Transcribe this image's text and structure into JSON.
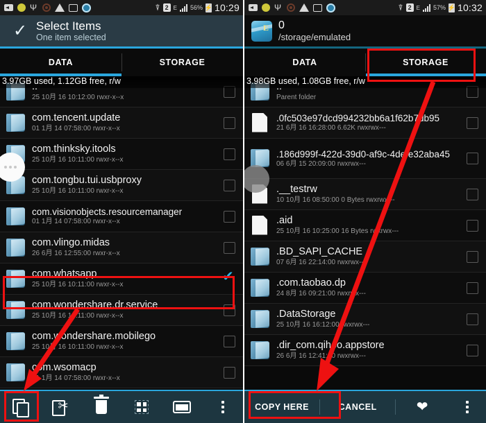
{
  "left": {
    "statusbar": {
      "icons": [
        "sdcard-icon",
        "coin-icon",
        "usb-icon",
        "record-icon",
        "warning-icon",
        "image-icon",
        "shield-icon"
      ],
      "wifi": "wifi-icon",
      "sim": "2",
      "network": "E",
      "battery_pct": "56%",
      "clock": "10:29"
    },
    "header": {
      "title": "Select Items",
      "subtitle": "One item selected",
      "check_icon": "check-icon"
    },
    "tabs": [
      {
        "label": "DATA",
        "selected": true
      },
      {
        "label": "STORAGE",
        "selected": false
      }
    ],
    "storage_info": "3.97GB used, 1.12GB free, r/w",
    "rows": [
      {
        "name": "..",
        "sub_date": "25 10月 16 10:12:00",
        "sub_perm": "rwxr-x--x",
        "type": "folder",
        "checked": false
      },
      {
        "name": "com.tencent.update",
        "sub_date": "01 1月 14 07:58:00",
        "sub_perm": "rwxr-x--x",
        "type": "folder",
        "checked": false
      },
      {
        "name": "com.thinksky.itools",
        "sub_date": "25 10月 16 10:11:00",
        "sub_perm": "rwxr-x--x",
        "type": "folder",
        "checked": false
      },
      {
        "name": "com.tongbu.tui.usbproxy",
        "sub_date": "25 10月 16 10:11:00",
        "sub_perm": "rwxr-x--x",
        "type": "folder",
        "checked": false
      },
      {
        "name": "com.visionobjects.resourcemanager",
        "sub_date": "01 1月 14 07:58:00",
        "sub_perm": "rwxr-x--x",
        "type": "folder",
        "checked": false
      },
      {
        "name": "com.vlingo.midas",
        "sub_date": "26 6月 16 12:55:00",
        "sub_perm": "rwxr-x--x",
        "type": "folder",
        "checked": false
      },
      {
        "name": "com.whatsapp",
        "sub_date": "25 10月 16 10:11:00",
        "sub_perm": "rwxr-x--x",
        "type": "folder",
        "checked": true
      },
      {
        "name": "com.wondershare.dr.service",
        "sub_date": "25 10月 16 10:11:00",
        "sub_perm": "rwxr-x--x",
        "type": "folder",
        "checked": false
      },
      {
        "name": "com.wondershare.mobilego",
        "sub_date": "25 10月 16 10:11:00",
        "sub_perm": "rwxr-x--x",
        "type": "folder",
        "checked": false
      },
      {
        "name": "com.wsomacp",
        "sub_date": "01 1月 14 07:58:00",
        "sub_perm": "rwxr-x--x",
        "type": "folder",
        "checked": false
      }
    ],
    "bottombar": [
      {
        "icon": "copy-icon",
        "name": "copy-button"
      },
      {
        "icon": "cut-icon",
        "name": "cut-button"
      },
      {
        "icon": "delete-icon",
        "name": "delete-button"
      },
      {
        "icon": "grid-view-icon",
        "name": "grid-view-button"
      },
      {
        "icon": "window-icon",
        "name": "window-button"
      },
      {
        "icon": "overflow-menu-icon",
        "name": "overflow-menu-button"
      }
    ]
  },
  "right": {
    "statusbar": {
      "icons": [
        "sdcard-icon",
        "coin-icon",
        "usb-icon",
        "record-icon",
        "warning-icon",
        "image-icon",
        "shield-icon"
      ],
      "wifi": "wifi-icon",
      "sim": "2",
      "network": "E",
      "battery_pct": "57%",
      "clock": "10:32"
    },
    "header": {
      "title": "0",
      "subtitle": "/storage/emulated",
      "app_icon": "es-file-explorer-icon"
    },
    "tabs": [
      {
        "label": "DATA",
        "selected": false
      },
      {
        "label": "STORAGE",
        "selected": true
      }
    ],
    "storage_info": "3.98GB used, 1.08GB free, r/w",
    "rows": [
      {
        "name": "..",
        "sub_date": "Parent folder",
        "sub_perm": "",
        "type": "folder",
        "checked": false
      },
      {
        "name": ".0fc503e97dcd994232bb6a1f62b7db95",
        "sub_date": "21 6月 16 16:28:00",
        "sub_size": "6.62K",
        "sub_perm": "rwxrwx---",
        "type": "file",
        "checked": false
      },
      {
        "name": ".186d999f-422d-39d0-af9c-4defe32aba45",
        "sub_date": "06 6月 15 20:09:00",
        "sub_perm": "rwxrwx---",
        "type": "folder",
        "checked": false
      },
      {
        "name": ".__testrw",
        "sub_date": "10 10月 16 08:50:00",
        "sub_size": "0 Bytes",
        "sub_perm": "rwxrwx---",
        "type": "file",
        "checked": false
      },
      {
        "name": ".aid",
        "sub_date": "25 10月 16 10:25:00",
        "sub_size": "16 Bytes",
        "sub_perm": "rwxrwx---",
        "type": "file",
        "checked": false
      },
      {
        "name": ".BD_SAPI_CACHE",
        "sub_date": "07 6月 16 22:14:00",
        "sub_perm": "rwxrwx---",
        "type": "folder",
        "checked": false
      },
      {
        "name": ".com.taobao.dp",
        "sub_date": "24 8月 16 09:21:00",
        "sub_perm": "rwxrwx---",
        "type": "folder",
        "checked": false
      },
      {
        "name": ".DataStorage",
        "sub_date": "25 10月 16 16:12:00",
        "sub_perm": "rwxrwx---",
        "type": "folder",
        "checked": false
      },
      {
        "name": ".dir_com.qihoo.appstore",
        "sub_date": "26 6月 16 12:41:00",
        "sub_perm": "rwxrwx---",
        "type": "folder",
        "checked": false
      }
    ],
    "bottombar": [
      {
        "label": "COPY HERE",
        "name": "copy-here-button"
      },
      {
        "label": "CANCEL",
        "name": "cancel-button"
      },
      {
        "icon": "heart-icon",
        "name": "favorite-button"
      },
      {
        "icon": "overflow-menu-icon",
        "name": "overflow-menu-button"
      }
    ]
  },
  "annotations": {
    "color": "#ee1111"
  }
}
